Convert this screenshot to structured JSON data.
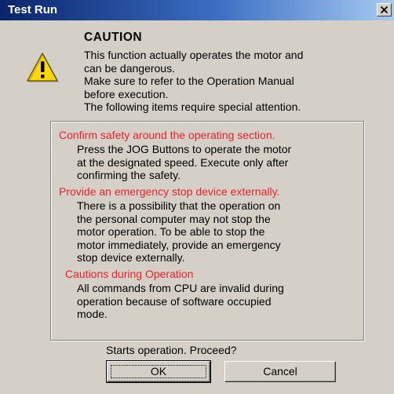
{
  "window": {
    "title": "Test Run",
    "close_label": "×"
  },
  "caution": {
    "heading": "CAUTION",
    "icon": "warning-triangle-icon",
    "lines": [
      "This function actually operates the motor and",
      "can be dangerous.",
      "Make sure to refer to the Operation Manual",
      "before execution.",
      "The following items require special attention."
    ]
  },
  "attention_items": [
    {
      "title": "Confirm safety around the operating section.",
      "body": [
        "Press the JOG Buttons to operate the motor",
        "at the designated speed. Execute only after",
        "confirming the safety."
      ]
    },
    {
      "title": "Provide an emergency stop device externally.",
      "body": [
        "There is a possibility that the operation on",
        "the personal computer may not stop the",
        "motor operation. To be able to stop the",
        "motor immediately, provide an emergency",
        "stop device externally."
      ]
    },
    {
      "title": "Cautions during Operation",
      "body": [
        "All commands from CPU are invalid during",
        "operation because of software occupied",
        "mode."
      ]
    }
  ],
  "prompt": {
    "question": "Starts operation. Proceed?"
  },
  "buttons": {
    "ok_label": "OK",
    "cancel_label": "Cancel"
  },
  "colors": {
    "title_bar": "#0a246a",
    "dialog_bg": "#d4d0c8",
    "item_title": "#e8202a",
    "warning_icon": "#ffd800"
  }
}
